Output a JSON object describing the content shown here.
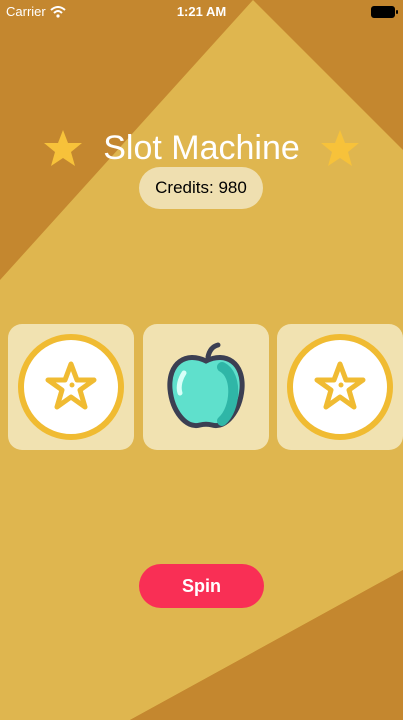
{
  "status_bar": {
    "carrier": "Carrier",
    "time": "1:21 AM"
  },
  "header": {
    "title": "Slot Machine",
    "decor_icon": "star-icon"
  },
  "credits": {
    "text": "Credits: 980"
  },
  "reels": [
    {
      "symbol": "star-coin-icon"
    },
    {
      "symbol": "apple-icon"
    },
    {
      "symbol": "star-coin-icon"
    }
  ],
  "spin_button": {
    "label": "Spin"
  },
  "colors": {
    "dark_gold": "#c4872f",
    "light_gold": "#dfb64f",
    "reel_bg": "#f1e2b1",
    "spin": "#f92f55",
    "star": "#f7c23a",
    "apple": "#5fe0cc"
  }
}
